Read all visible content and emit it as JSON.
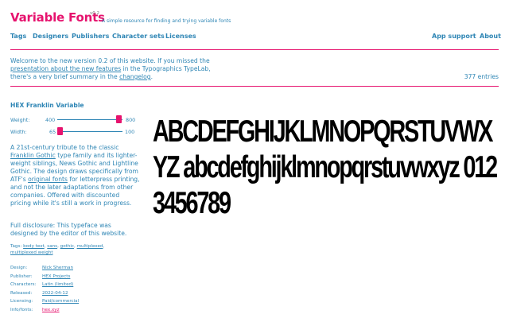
{
  "header": {
    "title": "Variable Fonts",
    "version": "v0.2",
    "tagline": "A simple resource for finding and trying variable fonts"
  },
  "nav": {
    "left": [
      "Tags",
      "Designers",
      "Publishers",
      "Character sets",
      "Licenses"
    ],
    "right": [
      "App support",
      "About"
    ]
  },
  "intro": {
    "p1": "Welcome to the new version 0.2 of this website. If you missed the",
    "link1": "presentation about the new features",
    "p2": " in the Typographics TypeLab,",
    "p3": "there's a very brief summary in the ",
    "link2": "changelog",
    "p4": "."
  },
  "entry_count": "377 entries",
  "font": {
    "name": "HEX Franklin Variable",
    "axes": [
      {
        "label": "Weight:",
        "min": "400",
        "max": "800",
        "level": 0.98
      },
      {
        "label": "Width:",
        "min": "65",
        "max": "100",
        "level": 0.0
      }
    ],
    "description": {
      "t1": "A 21st-century tribute to the classic ",
      "l1": "Franklin Gothic",
      "t2": " type family and its lighter-weight siblings, News Gothic and Lightline Gothic. The design draws specifically from ATF's ",
      "l2": "original fonts",
      "t3": " for letterpress printing, and not the later adaptations from other companies. Offered with discounted pricing while it's still a work in progress."
    },
    "disclosure": "Full disclosure: This typeface was designed by the editor of this website.",
    "tags_label": "Tags:",
    "tags": [
      "body text",
      "sans",
      "gothic",
      "multiplexed",
      "multiplexed weight"
    ],
    "meta": [
      {
        "label": "Design:",
        "value": "Nick Sherman"
      },
      {
        "label": "Publisher:",
        "value": "HEX Projects"
      },
      {
        "label": "Characters:",
        "value": "Latin (limited)"
      },
      {
        "label": "Released:",
        "value": "2022-04-12"
      },
      {
        "label": "Licensing:",
        "value": "Paid/commercial"
      },
      {
        "label": "Info/fonts:",
        "value": "hex.xyz"
      }
    ],
    "specimen": "ABCDEFGHIJKLMNOPQRSTUVWXYZ abcdefghijklmnopqrstuvwxyz 0123456789"
  },
  "colors": {
    "accent": "#e6136e",
    "link": "#2f86b5",
    "specimen": "#000000"
  }
}
